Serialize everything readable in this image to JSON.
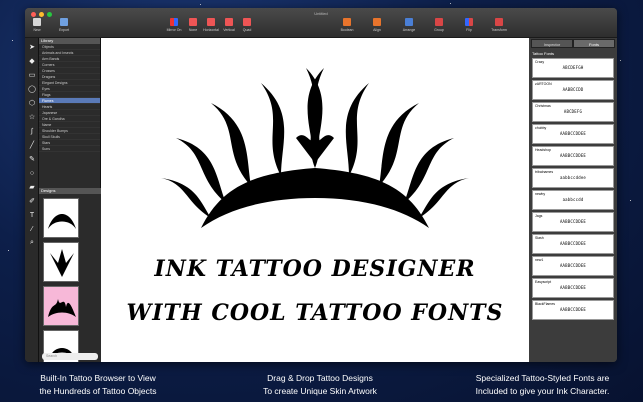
{
  "window": {
    "title": "Untitled"
  },
  "toolbar": {
    "left": [
      {
        "label": "New"
      },
      {
        "label": "Export"
      }
    ],
    "mid": [
      {
        "label": "Mirror On"
      },
      {
        "label": "None"
      },
      {
        "label": "Horizontal"
      },
      {
        "label": "Vertical"
      },
      {
        "label": "Quad"
      }
    ],
    "right": [
      {
        "label": "Boolean"
      },
      {
        "label": "Align"
      },
      {
        "label": "Arrange"
      },
      {
        "label": "Group"
      },
      {
        "label": "Flip"
      },
      {
        "label": "Transform"
      }
    ]
  },
  "library": {
    "header": "Library",
    "items": [
      {
        "label": "Objects"
      },
      {
        "label": "Animals and Insects"
      },
      {
        "label": "Arm Bands"
      },
      {
        "label": "Corners"
      },
      {
        "label": "Crosses"
      },
      {
        "label": "Dragons"
      },
      {
        "label": "Elegant Designs"
      },
      {
        "label": "Eyes"
      },
      {
        "label": "Flags"
      },
      {
        "label": "Flames"
      },
      {
        "label": "Hearts"
      },
      {
        "label": "Japanese"
      },
      {
        "label": "Ore & Gandha"
      },
      {
        "label": "Name"
      },
      {
        "label": "Shoulder Bumps"
      },
      {
        "label": "Skull Skulls"
      },
      {
        "label": "Stars"
      },
      {
        "label": "Suns"
      }
    ],
    "selected_index": 9,
    "designs_header": "Designs",
    "search_placeholder": "Search"
  },
  "canvas": {
    "line1": "INK TATTOO DESIGNER",
    "line2": "WITH COOL TATTOO FONTS"
  },
  "panel": {
    "tabs": [
      {
        "label": "Inspector"
      },
      {
        "label": "Fonts"
      }
    ],
    "active_tab": 1,
    "header": "Tattoo Fonts",
    "fonts": [
      {
        "name": "Crazy",
        "sample": "ABCDEFGH"
      },
      {
        "name": "zARTOON",
        "sample": "AABBCCDD"
      },
      {
        "name": "Christmas",
        "sample": "ABCDEFG"
      },
      {
        "name": "chubby",
        "sample": "AABBCCDDEE"
      },
      {
        "name": "Headshop",
        "sample": "AABBCCDDEE"
      },
      {
        "name": "tribalnames",
        "sample": "aabbccddee"
      },
      {
        "name": "newby",
        "sample": "aabbccdd"
      },
      {
        "name": "Jags",
        "sample": "AABBCCDDEE"
      },
      {
        "name": "Slash",
        "sample": "AABBCCDDEE"
      },
      {
        "name": "new1",
        "sample": "AABBCCDDEE"
      },
      {
        "name": "Easyscript",
        "sample": "AABBCCDDEE"
      },
      {
        "name": "BlackFlames",
        "sample": "AABBCCDDEE"
      }
    ]
  },
  "captions": [
    {
      "line1": "Built-In Tattoo Browser to View",
      "line2": "the Hundreds of Tattoo Objects"
    },
    {
      "line1": "Drag & Drop Tattoo Designs",
      "line2": "To create Unique Skin Artwork"
    },
    {
      "line1": "Specialized Tattoo-Styled Fonts are",
      "line2": "Included to give your Ink Character."
    }
  ]
}
